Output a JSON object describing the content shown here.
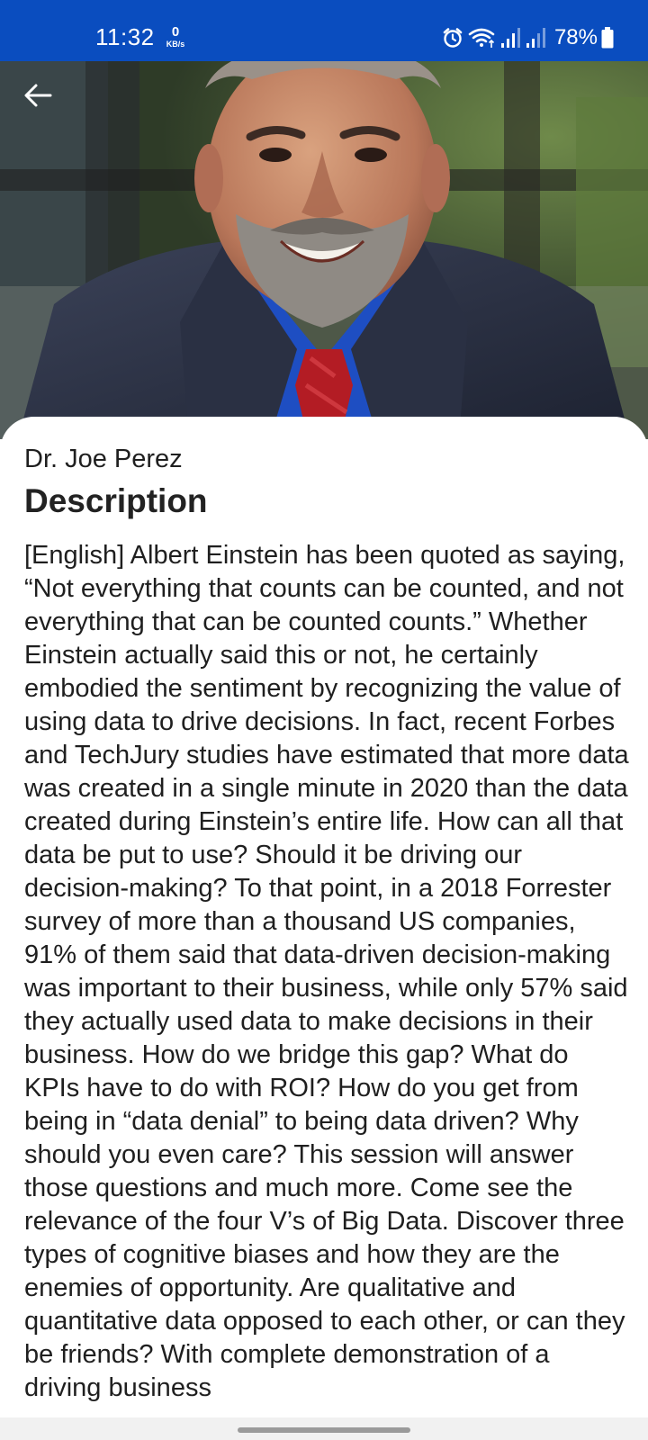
{
  "status_bar": {
    "time": "11:32",
    "net_speed_value": "0",
    "net_speed_unit": "KB/s",
    "battery": "78%",
    "icons": [
      "alarm-icon",
      "wifi-icon",
      "signal-icon",
      "signal-icon",
      "battery-icon"
    ]
  },
  "header": {
    "back_icon": "arrow-left-icon",
    "photo": "speaker-photo"
  },
  "session": {
    "speaker_name": "Dr. Joe Perez",
    "section_title": "Description",
    "description": "[English] Albert Einstein has been quoted as saying, “Not everything that counts can be counted, and not everything that can be counted counts.” Whether Einstein actually said this or not, he certainly embodied the sentiment by recognizing the value of using data to drive decisions. In fact, recent Forbes and TechJury studies have estimated that more data was created in a single minute in 2020 than the data created during Einstein’s entire life. How can all that data be put to use? Should it be driving our decision-making? To that point, in a 2018 Forrester survey of more than a thousand US companies, 91% of them said that data-driven decision-making was important to their business, while only 57% said they actually used data to make decisions in their business. How do we bridge this gap? What do KPIs have to do with ROI? How do you get from being in “data denial” to being data driven? Why should you even care? This session will answer those questions and much more. Come see the relevance of the four V’s of Big Data. Discover three types of cognitive biases and how they are the enemies of opportunity. Are qualitative and quantitative data opposed to each other, or can they be friends? With complete demonstration of a driving business"
  },
  "colors": {
    "status_bar": "#0a4dbf",
    "sheet": "#ffffff",
    "text": "#1f1f1f"
  }
}
